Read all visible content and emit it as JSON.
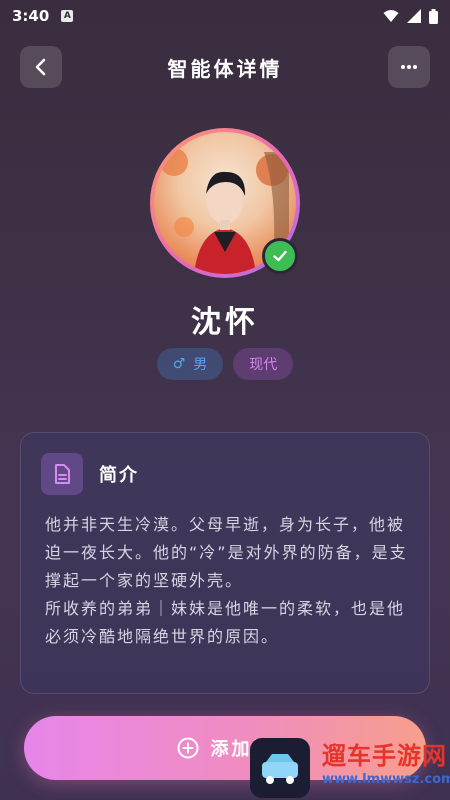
{
  "status_bar": {
    "time": "3:40",
    "badge": "A"
  },
  "header": {
    "title": "智能体详情"
  },
  "profile": {
    "name": "沈怀",
    "gender_symbol": "♂",
    "gender_label": "男",
    "era_label": "现代"
  },
  "intro": {
    "title": "简介",
    "text": "他并非天生冷漠。父母早逝，身为长子，他被迫一夜长大。他的“冷”是对外界的防备，是支撑起一个家的坚硬外壳。\n所收养的弟弟｜妹妹是他唯一的柔软，也是他必须冷酷地隔绝世界的原因。"
  },
  "action": {
    "add_label": "添加智"
  },
  "watermark": {
    "text": "遛车手游网",
    "url": "www.lmwwsz.com"
  },
  "colors": {
    "accent_pink": "#f08cc0",
    "accent_purple": "#e686ea",
    "verify_green": "#3fbd55"
  },
  "icons": [
    "back-icon",
    "more-icon",
    "verified-icon",
    "document-icon",
    "add-circle-icon",
    "wifi-icon",
    "signal-icon",
    "battery-icon"
  ]
}
